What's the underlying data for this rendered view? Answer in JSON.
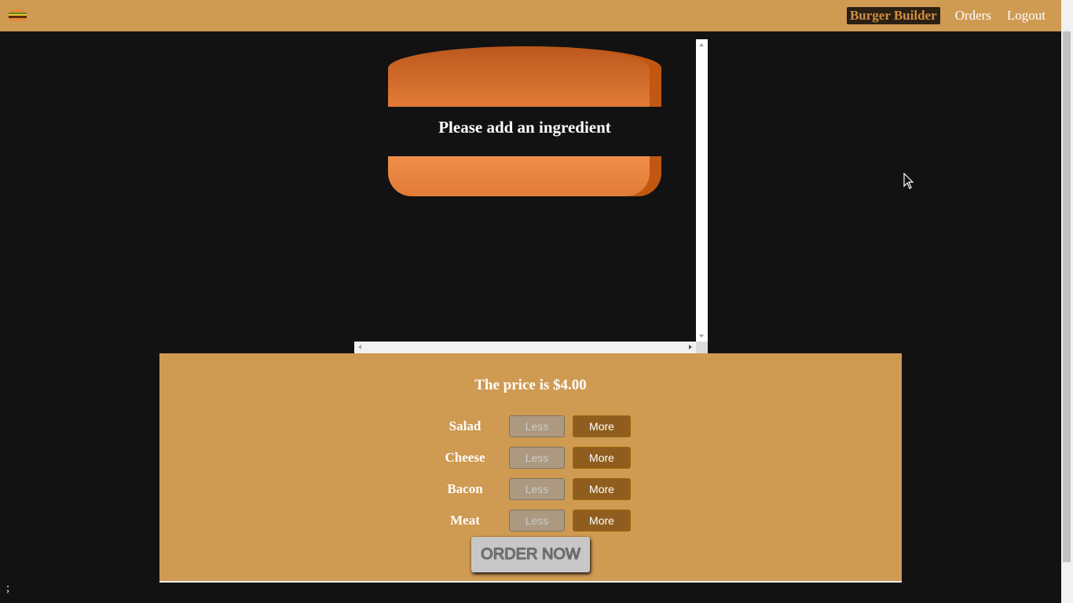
{
  "toolbar": {
    "logo_icon": "burger-logo-icon",
    "nav": {
      "burger_builder": "Burger Builder",
      "orders": "Orders",
      "logout": "Logout"
    }
  },
  "burger": {
    "message": "Please add an ingredient"
  },
  "build_controls": {
    "price_text": "The price is $4.00",
    "ingredients": [
      {
        "label": "Salad",
        "less": "Less",
        "more": "More"
      },
      {
        "label": "Cheese",
        "less": "Less",
        "more": "More"
      },
      {
        "label": "Bacon",
        "less": "Less",
        "more": "More"
      },
      {
        "label": "Meat",
        "less": "Less",
        "more": "More"
      }
    ],
    "order_button": "ORDER NOW"
  },
  "footer": {
    "text": ";"
  },
  "colors": {
    "toolbar_bg": "#CF9A52",
    "page_bg": "#121212",
    "more_button": "#8F5E1E",
    "less_button_disabled": "#AC9980",
    "bread": "#E27B36"
  }
}
